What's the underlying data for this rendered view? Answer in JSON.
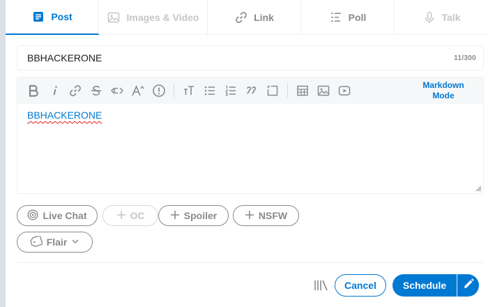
{
  "tabs": [
    {
      "label": "Post",
      "icon": "post-icon",
      "state": "active"
    },
    {
      "label": "Images & Video",
      "icon": "image-icon",
      "state": "disabled"
    },
    {
      "label": "Link",
      "icon": "link-icon",
      "state": "normal"
    },
    {
      "label": "Poll",
      "icon": "poll-icon",
      "state": "normal"
    },
    {
      "label": "Talk",
      "icon": "microphone-icon",
      "state": "disabled"
    }
  ],
  "title": {
    "value": "BBHACKERONE",
    "char_count": "11/300"
  },
  "editor": {
    "toolbar": [
      "bold",
      "italic",
      "link",
      "strikethrough",
      "inline-code",
      "superscript",
      "spoiler",
      "heading",
      "bulleted-list",
      "numbered-list",
      "quote",
      "code-block",
      "table",
      "image",
      "video"
    ],
    "markdown_mode_label": "Markdown Mode",
    "body": "BBHACKERONE"
  },
  "tags": {
    "live_chat": "Live Chat",
    "oc": "OC",
    "spoiler": "Spoiler",
    "nsfw": "NSFW",
    "flair": "Flair"
  },
  "actions": {
    "cancel": "Cancel",
    "schedule": "Schedule"
  },
  "colors": {
    "accent": "#0079d3",
    "muted": "#878a8c",
    "spell_error": "#e01b1b"
  }
}
